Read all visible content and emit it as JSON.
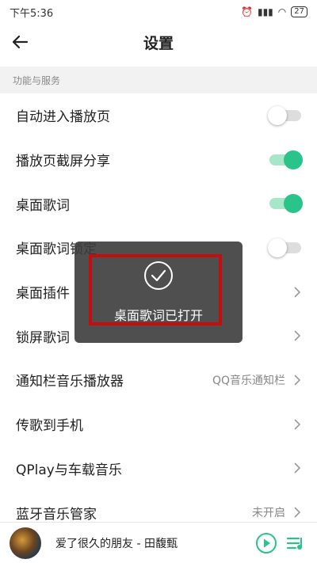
{
  "status_bar": {
    "time": "下午5:36",
    "battery": "27"
  },
  "header": {
    "title": "设置"
  },
  "section": {
    "label": "功能与服务"
  },
  "rows": [
    {
      "label": "自动进入播放页",
      "toggle_on": false
    },
    {
      "label": "播放页截屏分享",
      "toggle_on": true
    },
    {
      "label": "桌面歌词",
      "toggle_on": true
    },
    {
      "label": "桌面歌词锁定",
      "toggle_on": false
    },
    {
      "label": "桌面插件"
    },
    {
      "label": "锁屏歌词"
    },
    {
      "label": "通知栏音乐播放器",
      "value": "QQ音乐通知栏"
    },
    {
      "label": "传歌到手机"
    },
    {
      "label": "QPlay与车载音乐"
    },
    {
      "label": "蓝牙音乐管家",
      "value": "未开启"
    }
  ],
  "toast": {
    "text": "桌面歌词已打开",
    "icon": "check-circle-icon"
  },
  "player": {
    "song": "爱了很久的朋友 - 田馥甄"
  },
  "colors": {
    "accent": "#2ac38a",
    "highlight": "#c40d0d"
  }
}
